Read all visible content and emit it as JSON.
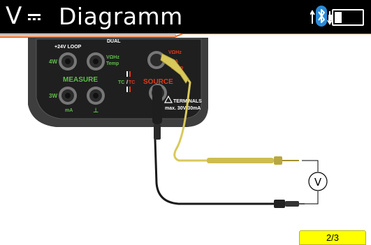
{
  "header": {
    "mode_symbol": "V",
    "title": "Diagramm",
    "accent_color": "#e8641e"
  },
  "status": {
    "icons": [
      "transfer-arrows-icon",
      "bluetooth-icon",
      "usb-icon",
      "battery-icon"
    ],
    "bluetooth_color": "#2a8ad8",
    "battery_level": 0.25
  },
  "diagram": {
    "meter": {
      "labels": {
        "loop": "+24V LOOP",
        "dual": "DUAL",
        "jack_4w": "4W",
        "jack_3w": "3W",
        "measure": "MEASURE",
        "vohz_temp": "VΩHz",
        "temp": "Temp",
        "ma": "mA",
        "ground": "⊥",
        "tc": "TC",
        "tc_slash": "/",
        "tc2": "TC",
        "source": "SOURCE",
        "source_vohz": "VΩHz",
        "source_ma": "mA",
        "source_temp": "Temp",
        "terminals": "TERMINALS",
        "rating": "max. 30V 30mA"
      }
    },
    "leads": [
      {
        "name": "yellow-test-lead",
        "color": "#d9c95a"
      },
      {
        "name": "black-test-lead",
        "color": "#1a1a1a"
      }
    ],
    "voltmeter_symbol": "V"
  },
  "pagination": {
    "label": "2/3"
  }
}
